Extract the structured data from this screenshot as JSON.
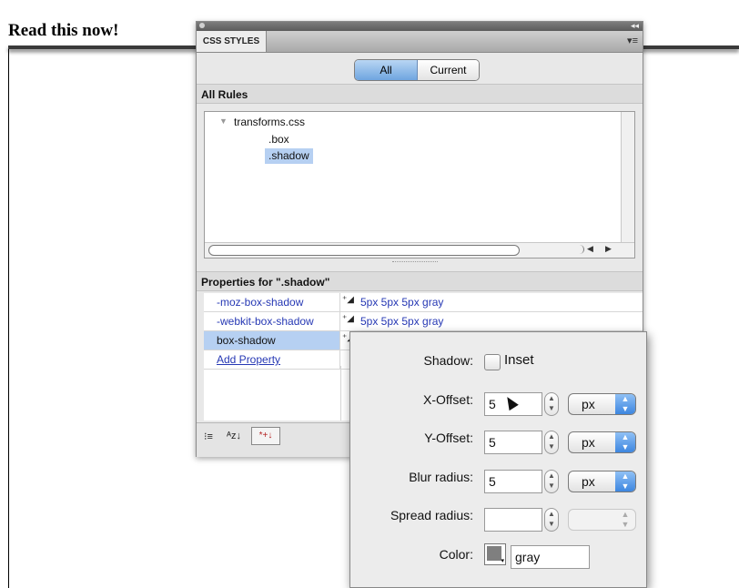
{
  "page": {
    "heading": "Read this now!"
  },
  "panel": {
    "tab_label": "CSS STYLES",
    "mode_tabs": [
      "All",
      "Current"
    ],
    "rules_header": "All Rules",
    "rules": {
      "file": "transforms.css",
      "items": [
        ".box",
        ".shadow"
      ]
    },
    "properties_header": "Properties for \".shadow\"",
    "properties": [
      {
        "name": "-moz-box-shadow",
        "value": "5px 5px 5px gray"
      },
      {
        "name": "-webkit-box-shadow",
        "value": "5px 5px 5px gray"
      },
      {
        "name": "box-shadow",
        "value": ""
      }
    ],
    "add_property": "Add Property",
    "toolbar": {
      "category_view": "⁝≡",
      "alpha_view": "ᴬz↓",
      "set_props": "*+↓"
    }
  },
  "popup": {
    "shadow_label": "Shadow:",
    "inset_label": "Inset",
    "x_offset_label": "X-Offset:",
    "x_offset_value": "5",
    "x_offset_unit": "px",
    "y_offset_label": "Y-Offset:",
    "y_offset_value": "5",
    "y_offset_unit": "px",
    "blur_label": "Blur radius:",
    "blur_value": "5",
    "blur_unit": "px",
    "spread_label": "Spread radius:",
    "spread_value": "",
    "color_label": "Color:",
    "color_value": "gray",
    "swatch_color": "#7f7f7f"
  },
  "colors": {
    "accent": "#6fa5e0",
    "link": "#2638b4",
    "selection": "#b6d0f2"
  }
}
